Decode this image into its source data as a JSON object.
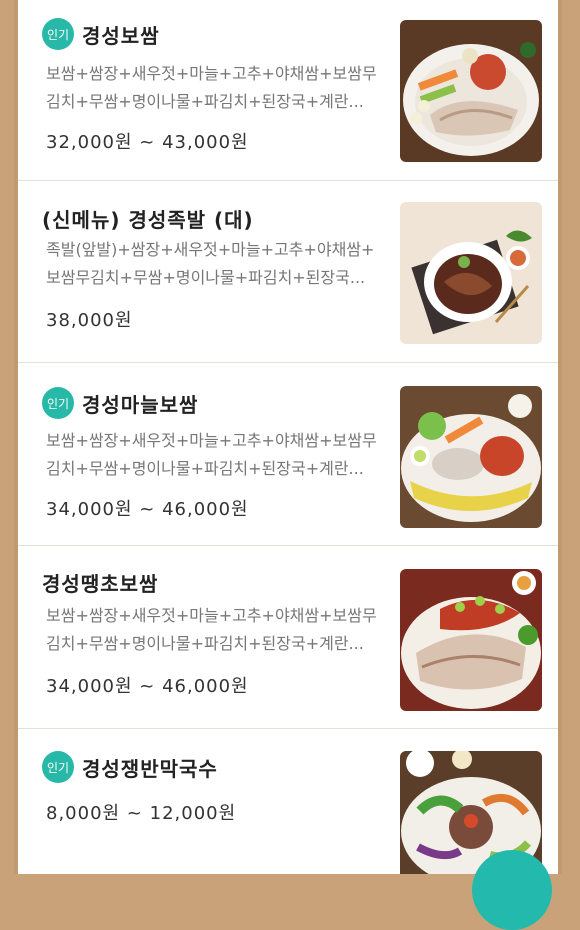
{
  "menu": [
    {
      "badge": "인기",
      "name": "경성보쌈",
      "desc_line1": "보쌈+쌈장+새우젓+마늘+고추+야채쌈+보쌈무",
      "desc_line2": "김치+무쌈+명이나물+파김치+된장국+계란...",
      "price": "32,000원 ~ 43,000원",
      "image": "bossam-platter"
    },
    {
      "name": "(신메뉴) 경성족발 (대)",
      "desc_line1": "족발(앞발)+쌈장+새우젓+마늘+고추+야채쌈+",
      "desc_line2": "보쌈무김치+무쌈+명이나물+파김치+된장국...",
      "price": "38,000원",
      "image": "jokbal-plate"
    },
    {
      "badge": "인기",
      "name": "경성마늘보쌈",
      "desc_line1": "보쌈+쌈장+새우젓+마늘+고추+야채쌈+보쌈무",
      "desc_line2": "김치+무쌈+명이나물+파김치+된장국+계란...",
      "price": "34,000원 ~ 46,000원",
      "image": "garlic-bossam-platter"
    },
    {
      "name": "경성땡초보쌈",
      "desc_line1": "보쌈+쌈장+새우젓+마늘+고추+야채쌈+보쌈무",
      "desc_line2": "김치+무쌈+명이나물+파김치+된장국+계란...",
      "price": "34,000원 ~ 46,000원",
      "image": "spicy-bossam-platter"
    },
    {
      "badge": "인기",
      "name": "경성쟁반막국수",
      "price": "8,000원 ~ 12,000원",
      "image": "makguksu-tray"
    }
  ]
}
